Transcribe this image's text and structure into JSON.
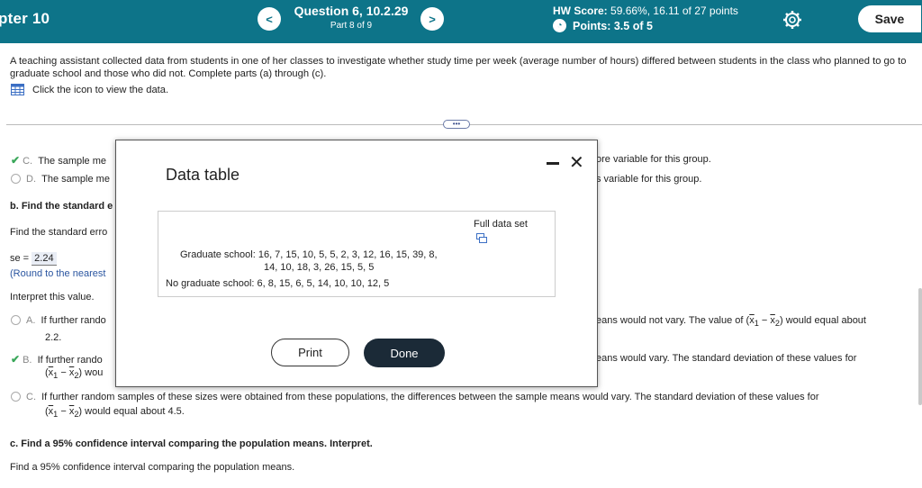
{
  "header": {
    "chapter": "pter 10",
    "question_title": "Question 6, 10.2.29",
    "question_part": "Part 8 of 9",
    "hw_score_label": "HW Score:",
    "hw_score_value": "59.66%, 16.11 of 27 points",
    "points_label": "Points:",
    "points_value": "3.5 of 5",
    "prev_icon": "<",
    "next_icon": ">",
    "save_label": "Save"
  },
  "problem": {
    "text": "A teaching assistant collected data from students in one of her classes to investigate whether study time per week (average number of hours) differed between students in the class who planned to go to graduate school and those who did not. Complete parts (a) through (c).",
    "view_data": "Click the icon to view the data.",
    "more_label": "•••"
  },
  "background": {
    "option_c_letter": "C.",
    "option_c_left": "The sample me",
    "option_c_right": "ore variable for this group.",
    "option_d_letter": "D.",
    "option_d_left": "The sample me",
    "option_d_right": "s variable for this group.",
    "part_b": "b. Find the standard e",
    "find_se": "Find the standard erro",
    "se_label": "se =",
    "se_value": "2.24",
    "round_note": "(Round to the nearest",
    "interpret": "Interpret this value.",
    "a_letter": "A.",
    "a_left": "If further rando",
    "a_right": "eans would not vary. The value of",
    "a_right2": "would equal about",
    "a_line2": "2.2.",
    "b_letter": "B.",
    "b_left": "If further rando",
    "b_right": "eans would vary. The standard deviation of these values for",
    "b_line2_end": "wou",
    "c_letter": "C.",
    "c_line1": "If further random samples of these sizes were obtained from these populations, the differences between the sample means would vary. The standard deviation of these values for",
    "c_line2": "would equal about 4.5.",
    "part_c": "c. Find a 95% confidence interval comparing the population means. Interpret.",
    "find_ci": "Find a 95% confidence interval comparing the population means.",
    "diff_expr_x1": "x",
    "diff_expr_sub1": "1",
    "diff_expr_minus": " − ",
    "diff_expr_x2": "x",
    "diff_expr_sub2": "2"
  },
  "modal": {
    "title": "Data table",
    "full_data_set": "Full data set",
    "grad_label_line1": "Graduate school: 16, 7, 15, 10, 5, 5, 2, 3, 12, 16, 15, 39, 8,",
    "grad_label_line2": "14, 10, 18, 3, 26, 15, 5, 5",
    "nograd_label": "No graduate school: 6, 8, 15, 6, 5, 14, 10, 10, 12, 5",
    "print_label": "Print",
    "done_label": "Done",
    "close_icon": "✕"
  }
}
